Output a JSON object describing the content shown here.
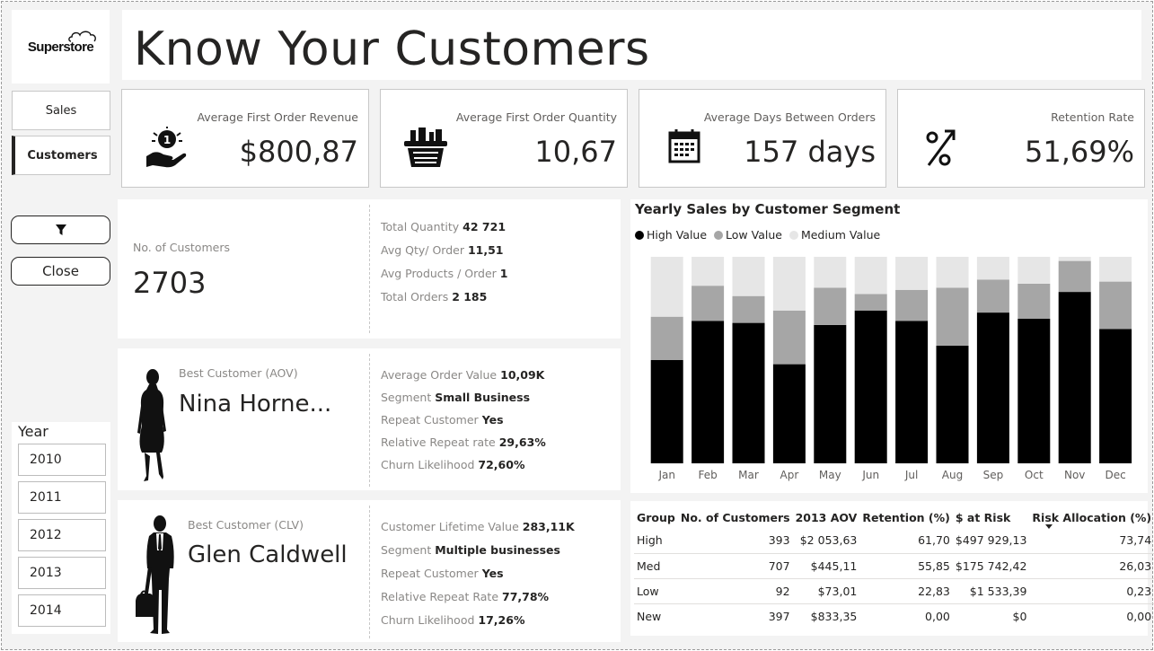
{
  "brand": {
    "logo_text": "Superstore"
  },
  "page": {
    "title": "Know Your Customers"
  },
  "nav": {
    "items": [
      {
        "label": "Sales",
        "active": false
      },
      {
        "label": "Customers",
        "active": true
      }
    ],
    "close_label": "Close"
  },
  "year_slicer": {
    "title": "Year",
    "options": [
      "2010",
      "2011",
      "2012",
      "2013",
      "2014"
    ]
  },
  "kpis": [
    {
      "label": "Average First Order Revenue",
      "value": "$800,87",
      "icon": "hand-coin-icon"
    },
    {
      "label": "Average First Order Quantity",
      "value": "10,67",
      "icon": "shopping-basket-icon"
    },
    {
      "label": "Average Days Between Orders",
      "value": "157 days",
      "icon": "calendar-icon"
    },
    {
      "label": "Retention Rate",
      "value": "51,69%",
      "icon": "percent-arrow-icon"
    }
  ],
  "customers_card": {
    "label": "No. of Customers",
    "value": "2703",
    "stats": [
      {
        "label": "Total Quantity",
        "value": "42 721"
      },
      {
        "label": "Avg Qty/ Order",
        "value": "11,51"
      },
      {
        "label": "Avg Products / Order",
        "value": "1"
      },
      {
        "label": "Total Orders",
        "value": "2 185"
      }
    ]
  },
  "best_aov": {
    "label": "Best Customer (AOV)",
    "name": "Nina Horne...",
    "stats": [
      {
        "label": "Average Order Value",
        "value": "10,09K"
      },
      {
        "label": "Segment",
        "value": "Small Business"
      },
      {
        "label": "Repeat Customer",
        "value": "Yes"
      },
      {
        "label": "Relative Repeat rate",
        "value": "29,63%"
      },
      {
        "label": "Churn Likelihood",
        "value": "72,60%"
      }
    ]
  },
  "best_clv": {
    "label": "Best Customer (CLV)",
    "name": "Glen Caldwell",
    "stats": [
      {
        "label": "Customer Lifetime Value",
        "value": "283,11K"
      },
      {
        "label": "Segment",
        "value": "Multiple businesses"
      },
      {
        "label": "Repeat Customer",
        "value": "Yes"
      },
      {
        "label": "Relative Repeat Rate",
        "value": "77,78%"
      },
      {
        "label": "Churn Likelihood",
        "value": "17,26%"
      }
    ]
  },
  "chart_data": {
    "type": "bar",
    "stacked": "100%",
    "title": "Yearly Sales by Customer Segment",
    "categories": [
      "Jan",
      "Feb",
      "Mar",
      "Apr",
      "May",
      "Jun",
      "Jul",
      "Aug",
      "Sep",
      "Oct",
      "Nov",
      "Dec"
    ],
    "series": [
      {
        "name": "High Value",
        "color": "#000000",
        "values": [
          50,
          69,
          68,
          48,
          67,
          74,
          69,
          57,
          73,
          70,
          83,
          65
        ]
      },
      {
        "name": "Low Value",
        "color": "#a6a6a6",
        "values": [
          21,
          17,
          13,
          26,
          18,
          8,
          15,
          28,
          16,
          17,
          15,
          23
        ]
      },
      {
        "name": "Medium Value",
        "color": "#e6e6e6",
        "values": [
          29,
          14,
          19,
          26,
          15,
          18,
          16,
          15,
          11,
          13,
          2,
          12
        ]
      }
    ],
    "ylim": [
      0,
      100
    ],
    "legend": "top-left",
    "grid": false
  },
  "segment_table": {
    "columns": [
      "Group",
      "No. of Customers",
      "2013 AOV",
      "Retention (%)",
      "$ at Risk",
      "Risk Allocation (%)"
    ],
    "rows": [
      [
        "High",
        "393",
        "$2 053,63",
        "61,70",
        "$497 929,13",
        "73,74"
      ],
      [
        "Med",
        "707",
        "$445,11",
        "55,85",
        "$175 742,42",
        "26,03"
      ],
      [
        "Low",
        "92",
        "$73,01",
        "22,83",
        "$1 533,39",
        "0,23"
      ],
      [
        "New",
        "397",
        "$833,35",
        "0,00",
        "$0",
        "0,00"
      ]
    ]
  }
}
